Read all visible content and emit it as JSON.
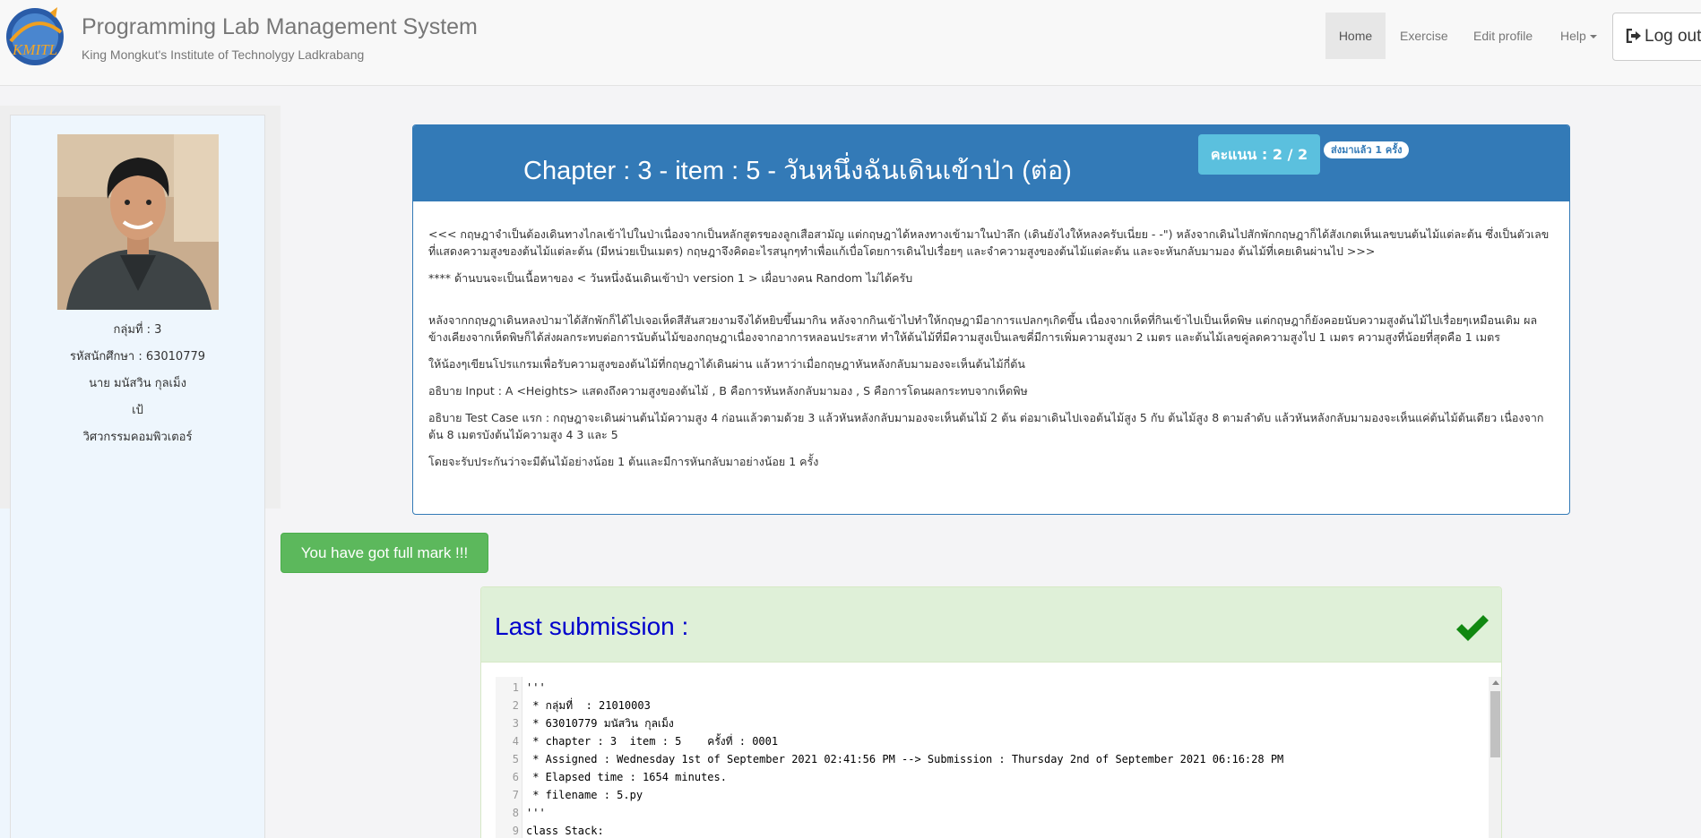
{
  "nav": {
    "logo_text": "KMITL",
    "title": "Programming Lab Management System",
    "subtitle": "King Mongkut's Institute of Technolygy Ladkrabang",
    "items": [
      {
        "label": "Home"
      },
      {
        "label": "Exercise"
      },
      {
        "label": "Edit profile"
      },
      {
        "label": "Help"
      }
    ],
    "logout_label": "Log out"
  },
  "profile": {
    "group": "กลุ่มที่ : 3",
    "student_id": "รหัสนักศึกษา : 63010779",
    "name": "นาย มนัสวิน กุลเม็ง",
    "nickname": "เป้",
    "faculty": "วิศวกรรมคอมพิวเตอร์"
  },
  "problem": {
    "title": "Chapter : 3 - item : 5 - วันหนึ่งฉันเดินเข้าป่า (ต่อ)",
    "score_label": "คะแนน : 2 / 2",
    "submitted_label": "ส่งมาแล้ว 1 ครั้ง",
    "paragraphs": [
      "<<<  กฤษฎาจำเป็นต้องเดินทางไกลเข้าไปในป่าเนื่องจากเป็นหลักสูตรของลูกเสือสามัญ  แต่กฤษฎาได้หลงทางเข้ามาในป่าลึก (เดินยังไงให้หลงครับเนี่ยย - -\") หลังจากเดินไปสักพักกฤษฎาก็ได้สังเกตเห็นเลขบนต้นไม้แต่ละต้น ซึ่งเป็นตัวเลขที่แสดงความสูงของต้นไม้แต่ละต้น (มีหน่วยเป็นเมตร) กฤษฎาจึงคิดอะไรสนุกๆทำเพื่อแก้เบื่อโดยการเดินไปเรื่อยๆ และจำความสูงของต้นไม้แต่ละต้น และจะหันกลับมามอง ต้นไม้ที่เคยเดินผ่านไป >>>",
      "****  ด้านบนจะเป็นเนื้อหาของ  < วันหนึ่งฉันเดินเข้าป่า   version  1 >  เผื่อบางคน Random ไม่ได้ครับ",
      "หลังจากกฤษฎาเดินหลงป่ามาได้สักพักก็ได้ไปเจอเห็ดสีสันสวยงามจึงได้หยิบขึ้นมากิน  หลังจากกินเข้าไปทำให้กฤษฎามีอาการแปลกๆเกิดขึ้น  เนื่องจากเห็ดที่กินเข้าไปเป็นเห็ดพิษ  แต่กฤษฎาก็ยังคอยนับความสูงต้นไม้ไปเรื่อยๆเหมือนเดิม  ผลข้างเคียงจากเห็ดพิษก็ได้ส่งผลกระทบต่อการนับต้นไม้ของกฤษฎาเนื่องจากอาการหลอนประสาท ทำให้ต้นไม้ที่มีความสูงเป็นเลขคี่มีการเพิ่มความสูงมา 2 เมตร และต้นไม้เลขคู่ลดความสูงไป  1 เมตร ความสูงที่น้อยที่สุดคือ 1 เมตร",
      "ให้น้องๆเขียนโปรแกรมเพื่อรับความสูงของต้นไม้ที่กฤษฎาได้เดินผ่าน  แล้วหาว่าเมื่อกฤษฎาหันหลังกลับมามองจะเห็นต้นไม้กี่ต้น",
      "อธิบาย Input :  A  <Heights>  แสดงถึงความสูงของต้นไม้  ,  B  คือการหันหลังกลับมามอง , S  คือการโดนผลกระทบจากเห็ดพิษ",
      "อธิบาย Test Case แรก : กฤษฎาจะเดินผ่านต้นไม้ความสูง  4   ก่อนแล้วตามด้วย  3   แล้วหันหลังกลับมามองจะเห็นต้นไม้ 2 ต้น ต่อมาเดินไปเจอต้นไม้สูง  5  กับ ต้นไม้สูง 8 ตามลำดับ  แล้วหันหลังกลับมามองจะเห็นแค่ต้นไม้ต้นเดียว  เนื่องจากต้น 8 เมตรบังต้นไม้ความสูง  4  3  และ  5",
      "โดยจะรับประกันว่าจะมีต้นไม้อย่างน้อย 1 ต้นและมีการหันกลับมาอย่างน้อย 1 ครั้ง"
    ]
  },
  "result": {
    "full_mark_label": "You have got full mark !!!"
  },
  "submission": {
    "title": "Last submission :",
    "status_icon": "check-icon",
    "code_lines": [
      {
        "n": "1",
        "text": "'''"
      },
      {
        "n": "2",
        "text": " * กลุ่มที่  : 21010003"
      },
      {
        "n": "3",
        "text": " * 63010779 มนัสวิน กุลเม็ง"
      },
      {
        "n": "4",
        "text": " * chapter : 3  item : 5    ครั้งที่ : 0001"
      },
      {
        "n": "5",
        "text": " * Assigned : Wednesday 1st of September 2021 02:41:56 PM --> Submission : Thursday 2nd of September 2021 06:16:28 PM"
      },
      {
        "n": "6",
        "text": " * Elapsed time : 1654 minutes."
      },
      {
        "n": "7",
        "text": " * filename : 5.py"
      },
      {
        "n": "8",
        "text": "'''"
      },
      {
        "n": "9",
        "text": "class Stack:"
      }
    ]
  },
  "colors": {
    "primary": "#337ab7",
    "success": "#5cb85c",
    "info": "#5bc0de",
    "panel_success_bg": "#dff0d8",
    "submission_title": "#0000cc",
    "check": "#118811"
  }
}
